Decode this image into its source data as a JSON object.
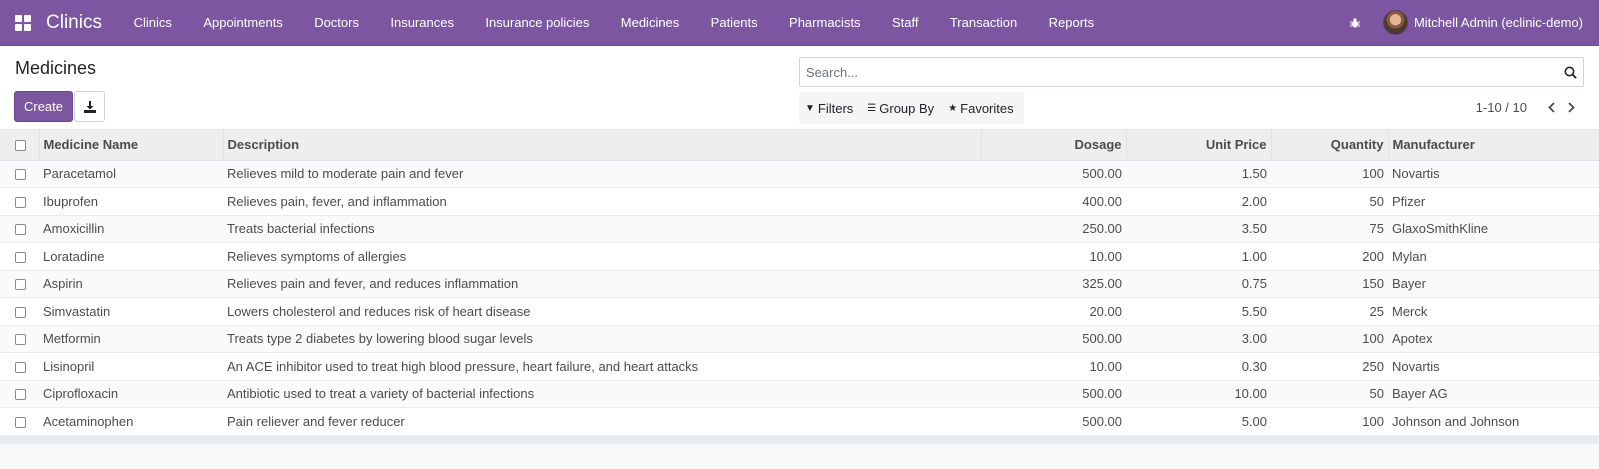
{
  "navbar": {
    "brand": "Clinics",
    "menu": [
      "Clinics",
      "Appointments",
      "Doctors",
      "Insurances",
      "Insurance policies",
      "Medicines",
      "Patients",
      "Pharmacists",
      "Staff",
      "Transaction",
      "Reports"
    ],
    "user_name": "Mitchell Admin (eclinic-demo)",
    "accent_color": "#7c56a1"
  },
  "control_panel": {
    "title": "Medicines",
    "create_label": "Create",
    "search_placeholder": "Search...",
    "filters_label": "Filters",
    "group_by_label": "Group By",
    "favorites_label": "Favorites",
    "pager": "1-10 / 10"
  },
  "table": {
    "headers": {
      "name": "Medicine Name",
      "description": "Description",
      "dosage": "Dosage",
      "unit_price": "Unit Price",
      "quantity": "Quantity",
      "manufacturer": "Manufacturer"
    },
    "rows": [
      {
        "name": "Paracetamol",
        "description": "Relieves mild to moderate pain and fever",
        "dosage": "500.00",
        "unit_price": "1.50",
        "quantity": "100",
        "manufacturer": "Novartis"
      },
      {
        "name": "Ibuprofen",
        "description": "Relieves pain, fever, and inflammation",
        "dosage": "400.00",
        "unit_price": "2.00",
        "quantity": "50",
        "manufacturer": "Pfizer"
      },
      {
        "name": "Amoxicillin",
        "description": "Treats bacterial infections",
        "dosage": "250.00",
        "unit_price": "3.50",
        "quantity": "75",
        "manufacturer": "GlaxoSmithKline"
      },
      {
        "name": "Loratadine",
        "description": "Relieves symptoms of allergies",
        "dosage": "10.00",
        "unit_price": "1.00",
        "quantity": "200",
        "manufacturer": "Mylan"
      },
      {
        "name": "Aspirin",
        "description": "Relieves pain and fever, and reduces inflammation",
        "dosage": "325.00",
        "unit_price": "0.75",
        "quantity": "150",
        "manufacturer": "Bayer"
      },
      {
        "name": "Simvastatin",
        "description": "Lowers cholesterol and reduces risk of heart disease",
        "dosage": "20.00",
        "unit_price": "5.50",
        "quantity": "25",
        "manufacturer": "Merck"
      },
      {
        "name": "Metformin",
        "description": "Treats type 2 diabetes by lowering blood sugar levels",
        "dosage": "500.00",
        "unit_price": "3.00",
        "quantity": "100",
        "manufacturer": "Apotex"
      },
      {
        "name": "Lisinopril",
        "description": "An ACE inhibitor used to treat high blood pressure, heart failure, and heart attacks",
        "dosage": "10.00",
        "unit_price": "0.30",
        "quantity": "250",
        "manufacturer": "Novartis"
      },
      {
        "name": "Ciprofloxacin",
        "description": "Antibiotic used to treat a variety of bacterial infections",
        "dosage": "500.00",
        "unit_price": "10.00",
        "quantity": "50",
        "manufacturer": "Bayer AG"
      },
      {
        "name": "Acetaminophen",
        "description": "Pain reliever and fever reducer",
        "dosage": "500.00",
        "unit_price": "5.00",
        "quantity": "100",
        "manufacturer": "Johnson and Johnson"
      }
    ]
  }
}
